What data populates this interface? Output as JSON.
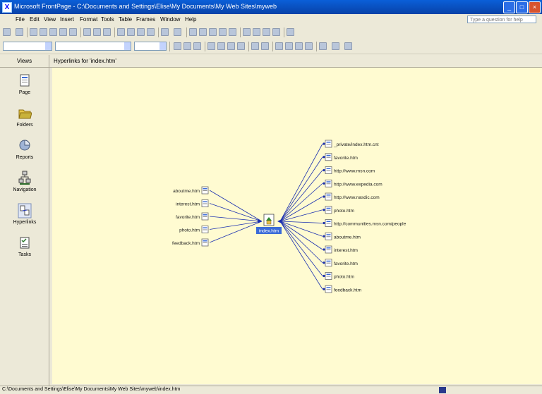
{
  "window": {
    "title": "Microsoft FrontPage - C:\\Documents and Settings\\Elise\\My Documents\\My Web Sites\\myweb"
  },
  "menu": [
    "File",
    "Edit",
    "View",
    "Insert",
    "Format",
    "Tools",
    "Table",
    "Frames",
    "Window",
    "Help"
  ],
  "help_box": {
    "placeholder": "Type a question for help"
  },
  "views_header": "Views",
  "doc_tab": "Hyperlinks for 'index.htm'",
  "views": [
    {
      "label": "Page",
      "icon": "page-view-icon"
    },
    {
      "label": "Folders",
      "icon": "folders-view-icon"
    },
    {
      "label": "Reports",
      "icon": "reports-view-icon"
    },
    {
      "label": "Navigation",
      "icon": "navigation-view-icon"
    },
    {
      "label": "Hyperlinks",
      "icon": "hyperlinks-view-icon"
    },
    {
      "label": "Tasks",
      "icon": "tasks-view-icon"
    }
  ],
  "diagram": {
    "center": {
      "label": "index.htm"
    },
    "incoming": [
      "aboutme.htm",
      "interest.htm",
      "favorite.htm",
      "photo.htm",
      "feedback.htm"
    ],
    "outgoing": [
      "_private/index.htm.cnt",
      "favorite.htm",
      "http://www.msn.com",
      "http://www.expedia.com",
      "http://www.nasdic.com",
      "photo.htm",
      "http://communities.msn.com/people",
      "aboutme.htm",
      "interest.htm",
      "favorite.htm",
      "photo.htm",
      "feedback.htm"
    ]
  },
  "status": {
    "path": "C:\\Documents and Settings\\Elise\\My Documents\\My Web Sites\\myweb\\index.htm"
  }
}
